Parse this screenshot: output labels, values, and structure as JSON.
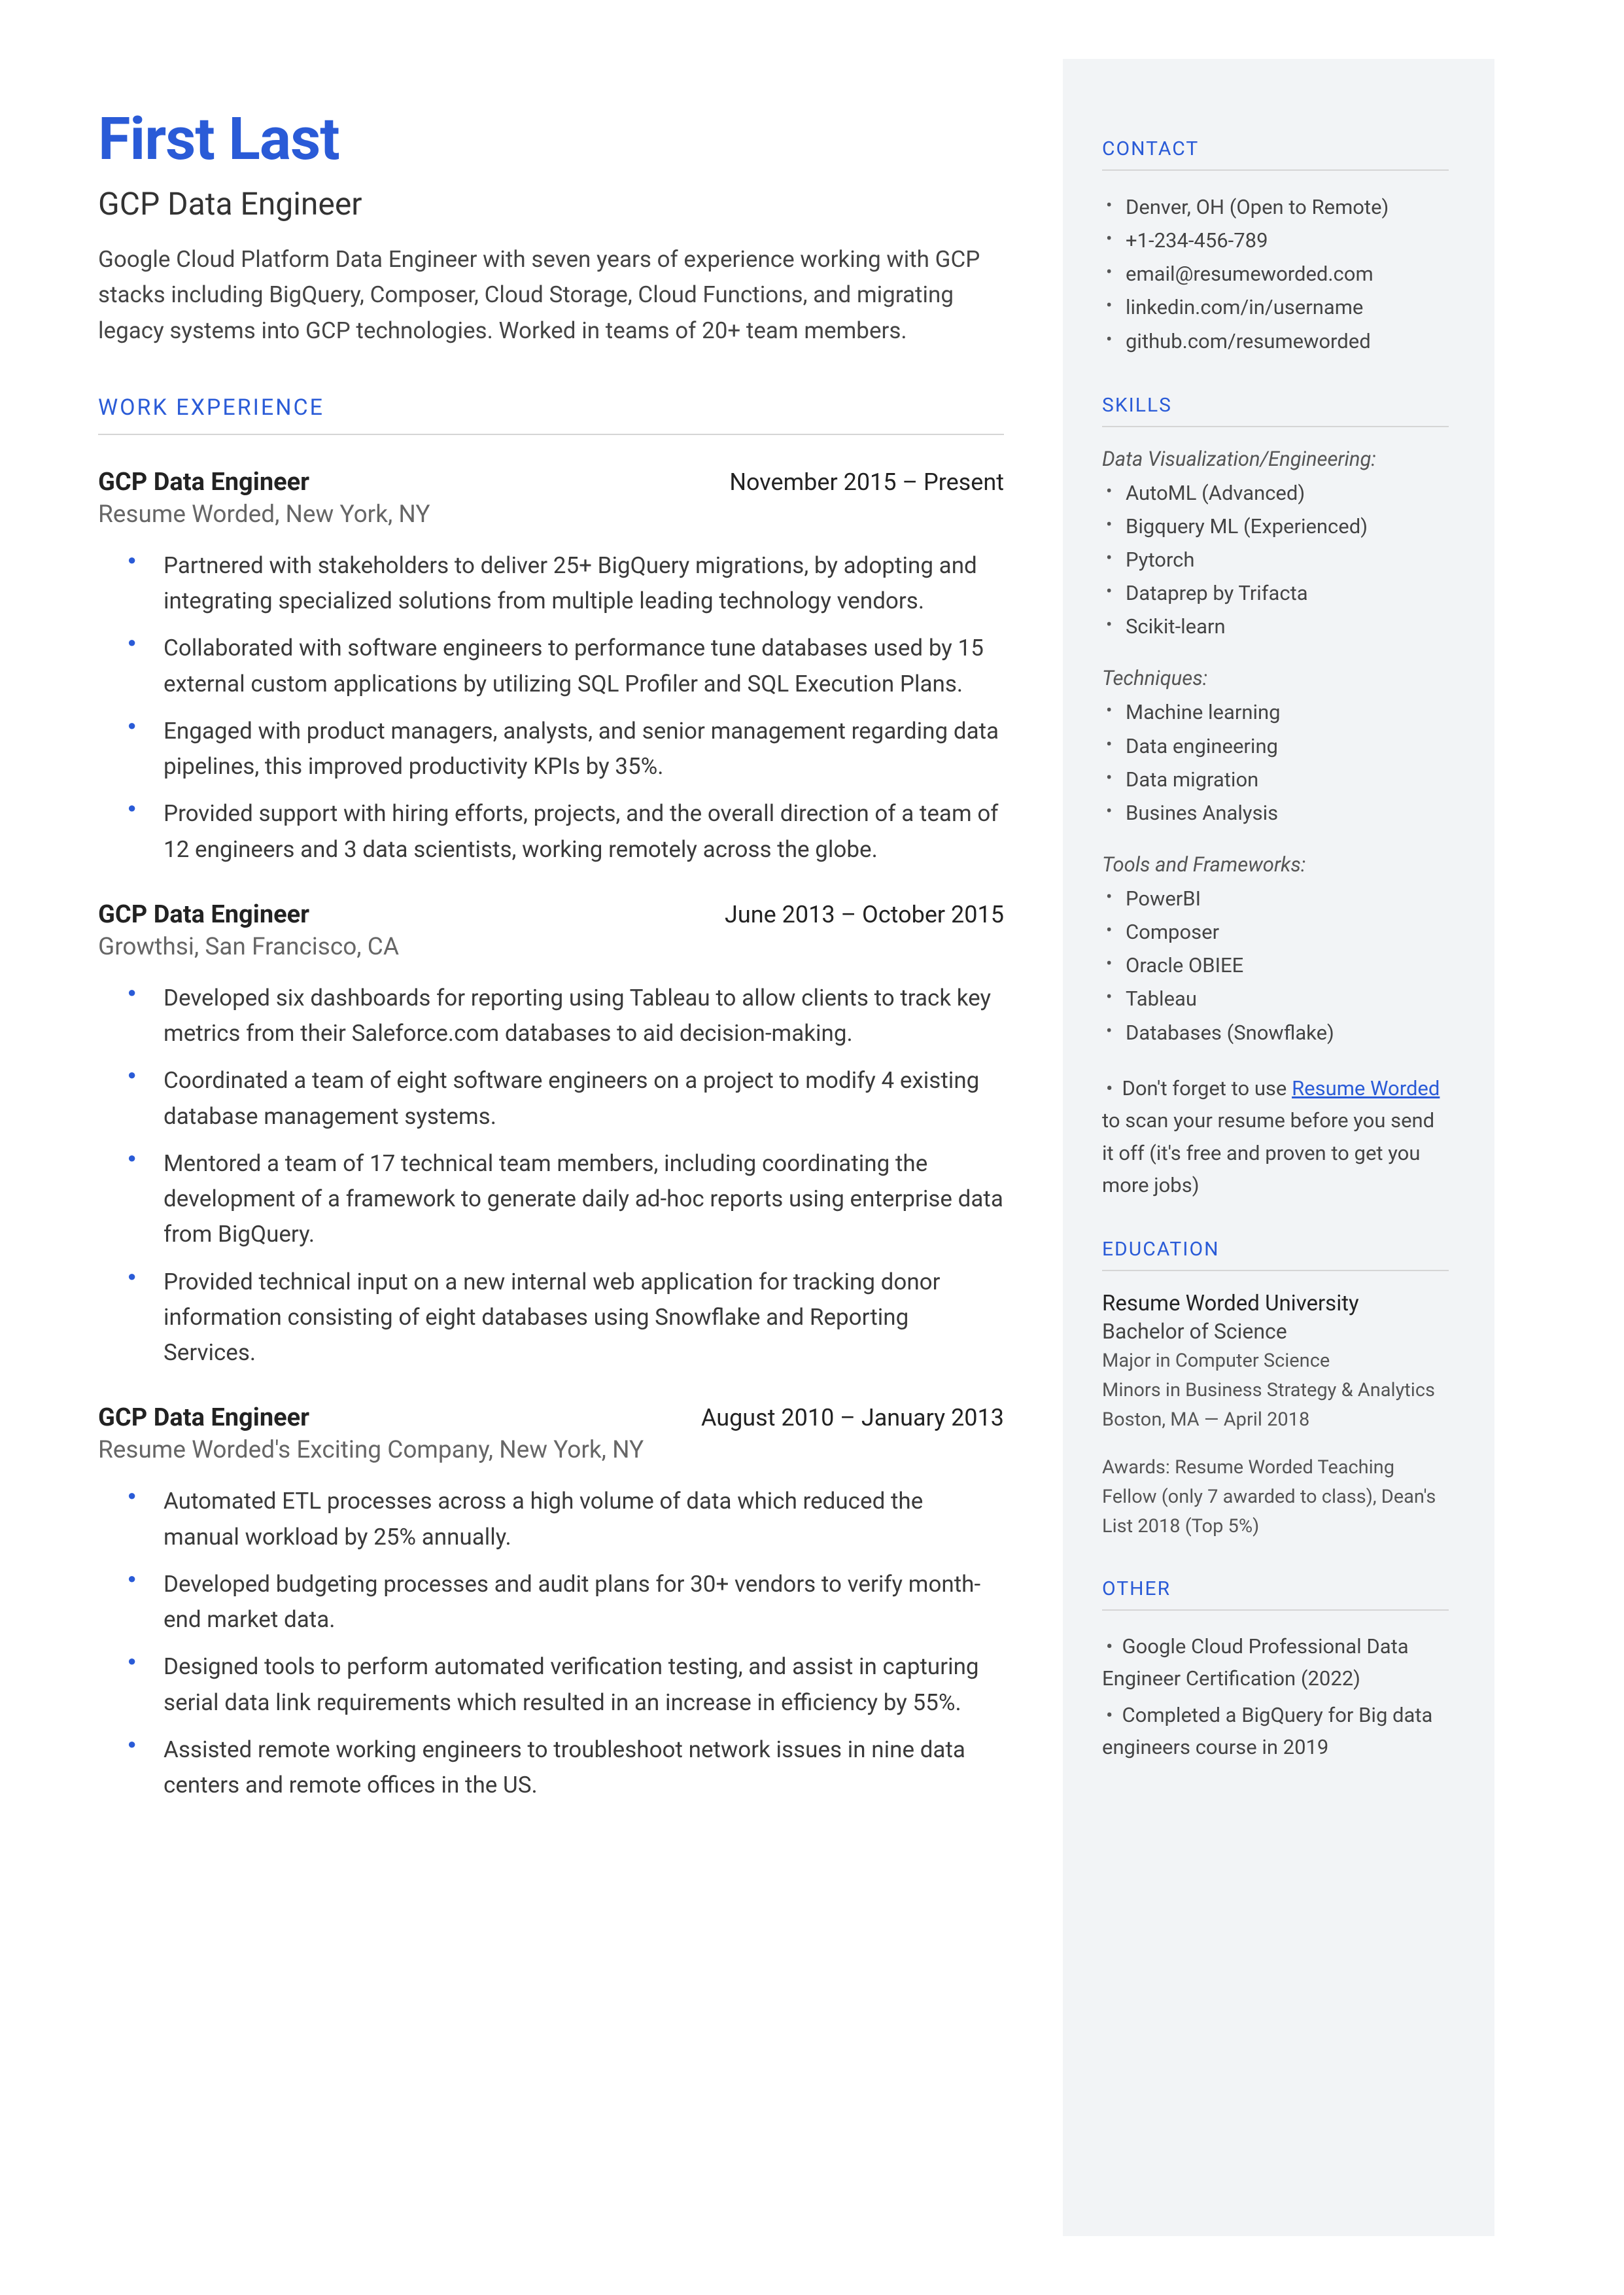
{
  "header": {
    "name": "First Last",
    "title": "GCP Data Engineer",
    "summary": "Google Cloud Platform Data Engineer with seven years of experience working with GCP stacks including BigQuery, Composer, Cloud Storage, Cloud Functions, and migrating legacy systems into GCP technologies. Worked in teams of 20+  team members."
  },
  "work_heading": "WORK EXPERIENCE",
  "jobs": [
    {
      "title": "GCP Data Engineer",
      "dates": "November 2015 – Present",
      "company": "Resume Worded, New York, NY",
      "bullets": [
        "Partnered with stakeholders to deliver 25+ BigQuery migrations, by adopting and integrating specialized solutions from multiple leading technology vendors.",
        "Collaborated with software engineers to performance tune databases used by 15 external custom applications by utilizing SQL Profiler and SQL Execution Plans.",
        "Engaged with product managers, analysts, and senior management regarding data pipelines, this improved productivity KPIs by 35%.",
        "Provided support with hiring efforts, projects, and the overall direction of a team of 12 engineers and 3 data scientists, working remotely across the globe."
      ]
    },
    {
      "title": "GCP Data Engineer",
      "dates": "June 2013 – October 2015",
      "company": "Growthsi, San Francisco, CA",
      "bullets": [
        "Developed six dashboards for reporting using Tableau to allow clients to track key metrics from their Saleforce.com databases to aid decision-making.",
        "Coordinated a team of eight software engineers on a project to modify 4 existing database management systems.",
        "Mentored a team of 17 technical team members, including coordinating the development of a framework to generate daily ad-hoc reports using enterprise data from BigQuery.",
        "Provided technical input on a new internal web application for tracking donor information consisting of eight databases using Snowflake and Reporting Services."
      ]
    },
    {
      "title": "GCP Data Engineer",
      "dates": "August 2010 – January 2013",
      "company": "Resume Worded's Exciting Company, New York, NY",
      "bullets": [
        "Automated ETL processes across a high volume of data which reduced the manual workload by 25% annually.",
        "Developed budgeting processes and audit plans for 30+ vendors to verify month-end market data.",
        "Designed tools to perform automated verification testing, and assist in capturing serial data link requirements which resulted in an increase in efficiency by 55%.",
        "Assisted remote working engineers to troubleshoot network issues in nine data centers and remote offices in the US."
      ]
    }
  ],
  "contact": {
    "heading": "CONTACT",
    "items": [
      "Denver, OH (Open to Remote)",
      "+1-234-456-789",
      "email@resumeworded.com",
      "linkedin.com/in/username",
      "github.com/resumeworded"
    ]
  },
  "skills": {
    "heading": "SKILLS",
    "groups": [
      {
        "title": "Data Visualization/Engineering:",
        "items": [
          "AutoML (Advanced)",
          "Bigquery ML (Experienced)",
          "Pytorch",
          "Dataprep by Trifacta",
          "Scikit-learn"
        ]
      },
      {
        "title": "Techniques:",
        "items": [
          "Machine learning",
          "Data engineering",
          "Data migration",
          "Busines Analysis"
        ]
      },
      {
        "title": "Tools and Frameworks:",
        "items": [
          "PowerBI",
          "Composer",
          "Oracle OBIEE",
          "Tableau",
          "Databases (Snowflake)"
        ]
      }
    ],
    "note_prefix": "Don't forget to use ",
    "note_link": "Resume Worded",
    "note_suffix": " to scan your resume before you send it off (it's free and proven to get you more jobs)"
  },
  "education": {
    "heading": "EDUCATION",
    "school": "Resume Worded University",
    "degree": "Bachelor of Science",
    "major": "Major in Computer Science",
    "minor": "Minors in Business Strategy & Analytics",
    "location": "Boston, MA — April 2018",
    "awards": "Awards: Resume Worded Teaching Fellow (only 7 awarded to class), Dean's List 2018 (Top 5%)"
  },
  "other": {
    "heading": "OTHER",
    "items": [
      "Google Cloud Professional Data Engineer Certification (2022)",
      "Completed a BigQuery for Big data engineers course in 2019"
    ]
  }
}
